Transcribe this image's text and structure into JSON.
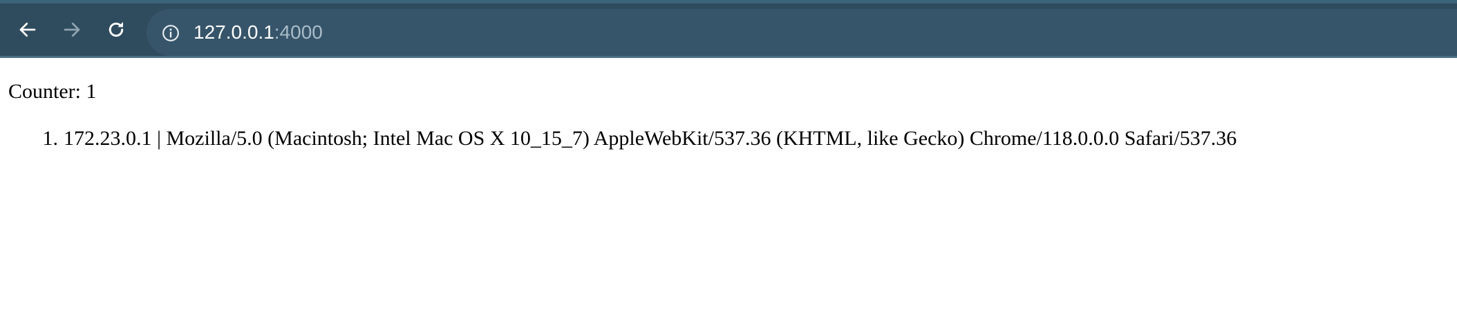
{
  "browser": {
    "url_host": "127.0.0.1",
    "url_port": ":4000",
    "icons": {
      "back": "arrow-left-icon",
      "forward": "arrow-right-icon",
      "reload": "reload-icon",
      "site_info": "info-icon"
    },
    "forward_enabled": false,
    "colors": {
      "toolbar": "#2f4b5e",
      "omnibox": "#37556a"
    }
  },
  "page": {
    "counter_text": "Counter: 1",
    "visits": [
      {
        "number": "1.",
        "text": "172.23.0.1 | Mozilla/5.0 (Macintosh; Intel Mac OS X 10_15_7) AppleWebKit/537.36 (KHTML, like Gecko) Chrome/118.0.0.0 Safari/537.36"
      }
    ]
  }
}
